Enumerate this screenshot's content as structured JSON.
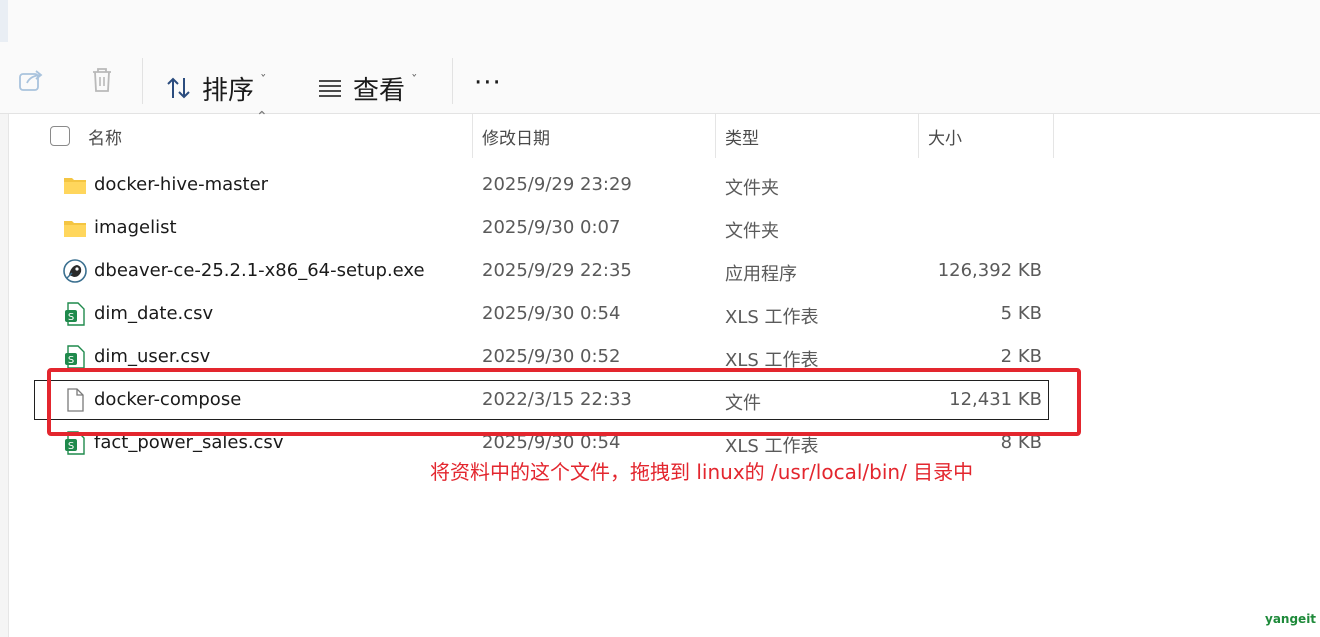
{
  "toolbar": {
    "sort_label": "排序",
    "view_label": "查看",
    "more_label": "···",
    "chevron": "ˇ"
  },
  "columns": {
    "name": "名称",
    "modified": "修改日期",
    "type": "类型",
    "size": "大小"
  },
  "files": [
    {
      "icon": "folder-icon",
      "name": "docker-hive-master",
      "modified": "2025/9/29 23:29",
      "type": "文件夹",
      "size": ""
    },
    {
      "icon": "folder-icon",
      "name": "imagelist",
      "modified": "2025/9/30 0:07",
      "type": "文件夹",
      "size": ""
    },
    {
      "icon": "dbeaver-app-icon",
      "name": "dbeaver-ce-25.2.1-x86_64-setup.exe",
      "modified": "2025/9/29 22:35",
      "type": "应用程序",
      "size": "126,392 KB"
    },
    {
      "icon": "spreadsheet-icon",
      "name": "dim_date.csv",
      "modified": "2025/9/30 0:54",
      "type": "XLS 工作表",
      "size": "5 KB"
    },
    {
      "icon": "spreadsheet-icon",
      "name": "dim_user.csv",
      "modified": "2025/9/30 0:52",
      "type": "XLS 工作表",
      "size": "2 KB"
    },
    {
      "icon": "file-icon",
      "name": "docker-compose",
      "modified": "2022/3/15 22:33",
      "type": "文件",
      "size": "12,431 KB"
    },
    {
      "icon": "spreadsheet-icon",
      "name": "fact_power_sales.csv",
      "modified": "2025/9/30 0:54",
      "type": "XLS 工作表",
      "size": "8 KB"
    }
  ],
  "annotation": "将资料中的这个文件，拖拽到 linux的 /usr/local/bin/ 目录中",
  "watermark": "yangeit",
  "colors": {
    "highlight": "#e3262e",
    "folder": "#f4c542",
    "spreadsheet": "#1f8a4c"
  }
}
